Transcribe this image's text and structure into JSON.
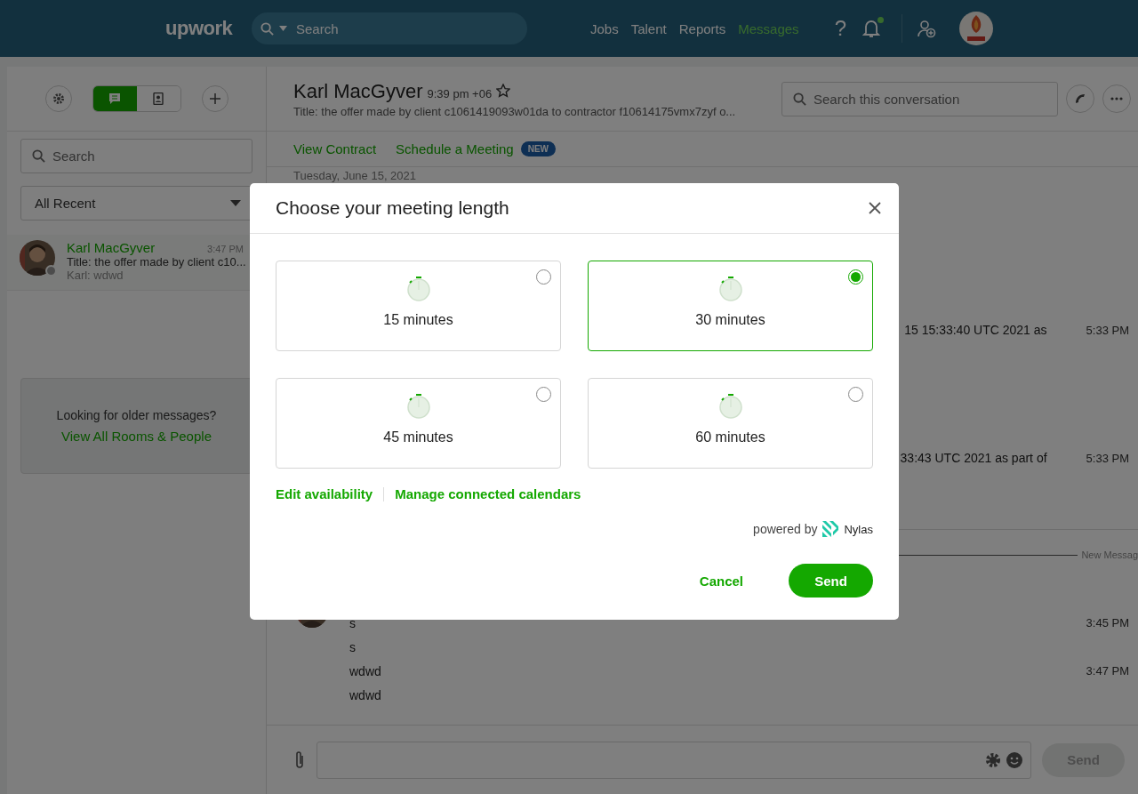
{
  "top_nav": {
    "logo": "upwork",
    "search": {
      "placeholder": "Search"
    },
    "links": [
      {
        "label": "Jobs",
        "selected": false
      },
      {
        "label": "Talent",
        "selected": false
      },
      {
        "label": "Reports",
        "selected": false
      },
      {
        "label": "Messages",
        "selected": true
      }
    ],
    "help": "?",
    "notifications": {
      "unread": true
    }
  },
  "sidebar": {
    "view_toggle": [
      {
        "kind": "chat",
        "selected": true
      },
      {
        "kind": "contacts",
        "selected": false
      }
    ],
    "search": {
      "placeholder": "Search"
    },
    "filter": "All Recent",
    "conversations": [
      {
        "name": "Karl MacGyver",
        "time": "3:47 PM",
        "title": "Title: the offer made by client c10...",
        "preview": "Karl: wdwd",
        "online": false
      }
    ],
    "older": {
      "text": "Looking for older messages?",
      "link": "View All Rooms & People"
    }
  },
  "chat": {
    "name": "Karl MacGyver",
    "time": "9:39 pm +06",
    "starred": false,
    "subtitle": "Title: the offer made by client c1061419093w01da to contractor f10614175vmx7zyf o...",
    "search": {
      "placeholder": "Search this conversation"
    },
    "links": [
      "View Contract",
      "Schedule a Meeting"
    ],
    "badge": "NEW",
    "date": "Tuesday, June 15, 2021",
    "messages": [
      {
        "text": "15 15:33:40 UTC 2021 as",
        "time": "5:33 PM"
      },
      {
        "text": "33:43 UTC 2021 as part of",
        "time": "5:33 PM"
      }
    ],
    "new_divider": "New Messag",
    "recent_messages": [
      {
        "text": "s",
        "time": "3:45 PM"
      },
      {
        "text": "s"
      },
      {
        "text": "wdwd",
        "time": "3:47 PM"
      },
      {
        "text": "wdwd"
      }
    ],
    "composer": {
      "send": "Send",
      "send_disabled": true
    }
  },
  "modal": {
    "title": "Choose your meeting length",
    "options": [
      {
        "label": "15 minutes",
        "selected": false
      },
      {
        "label": "30 minutes",
        "selected": true
      },
      {
        "label": "45 minutes",
        "selected": false
      },
      {
        "label": "60 minutes",
        "selected": false
      }
    ],
    "links": [
      "Edit availability",
      "Manage connected calendars"
    ],
    "powered_by": "powered by",
    "provider": "Nylas",
    "cancel": "Cancel",
    "send": "Send"
  }
}
